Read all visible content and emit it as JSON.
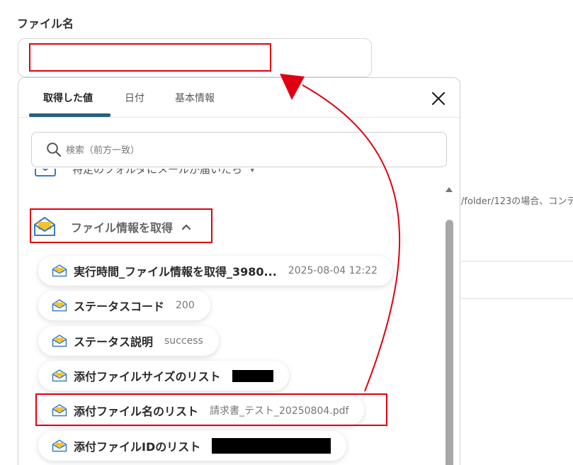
{
  "field": {
    "label": "ファイル名",
    "value": ""
  },
  "background": {
    "snippet": "/folder/123の場合、コンテ"
  },
  "dropdown": {
    "tabs": [
      {
        "label": "取得した値",
        "active": true
      },
      {
        "label": "日付",
        "active": false
      },
      {
        "label": "基本情報",
        "active": false
      }
    ],
    "search": {
      "placeholder": "検索（前方一致）",
      "value": ""
    },
    "cut_section": {
      "label": "特定のフォルダにメールが届いたら",
      "icon": "envelope-icon"
    },
    "section": {
      "label": "ファイル情報を取得",
      "expanded": true,
      "icon": "envelope-open-icon"
    },
    "items": [
      {
        "label": "実行時間_ファイル情報を取得_3980...",
        "value": "2025-08-04 12:22"
      },
      {
        "label": "ステータスコード",
        "value": "200"
      },
      {
        "label": "ステータス説明",
        "value": "success"
      },
      {
        "label": "添付ファイルサイズのリスト",
        "value": "",
        "redacted": true
      },
      {
        "label": "添付ファイル名のリスト",
        "value": "請求書_テスト_20250804.pdf",
        "highlighted": true
      },
      {
        "label": "添付ファイルIDのリスト",
        "value": "",
        "redacted": true
      }
    ]
  },
  "colors": {
    "accent": "#25627a",
    "highlight": "#e00012",
    "icon_blue": "#3a7bbf",
    "icon_yellow": "#f2c230"
  }
}
